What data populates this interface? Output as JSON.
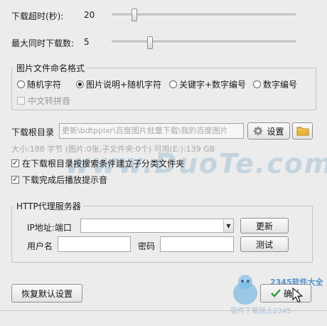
{
  "timeout": {
    "label": "下载超时(秒):",
    "value": "20"
  },
  "max_downloads": {
    "label": "最大同时下载数:",
    "value": "5"
  },
  "naming": {
    "title": "图片文件命名格式",
    "options": [
      "随机字符",
      "图片说明+随机字符",
      "关键字+数字编号",
      "数字编号"
    ],
    "selected_index": 1,
    "pinyin_label": "中文转拼音"
  },
  "download_root": {
    "label": "下载根目录",
    "path": "更新\\bdtpplxr\\百度图片批量下载\\我的百度图片",
    "settings_button": "设置",
    "info": "大小:188 字节 (图片:0张,子文件夹:0个)   可用(E:):139 GB"
  },
  "checkboxes": [
    {
      "label": "在下载根目录按搜索条件建立子分类文件夹",
      "checked": true
    },
    {
      "label": "下载完成后播放提示音",
      "checked": true
    }
  ],
  "proxy": {
    "title": "HTTP代理服务器",
    "ip_label": "IP地址:端口",
    "update_button": "更新",
    "user_label": "用户名",
    "password_label": "密码",
    "test_button": "测试"
  },
  "buttons": {
    "restore": "恢复默认设置",
    "confirm": "确认"
  },
  "watermark": {
    "site_text": "www.DuoTe.com",
    "logo_text": "2345软件大全",
    "slogan": "软件下载就上2345"
  },
  "icons": {
    "settings": "gear-icon",
    "folder": "folder-icon",
    "check": "checkmark-icon"
  }
}
